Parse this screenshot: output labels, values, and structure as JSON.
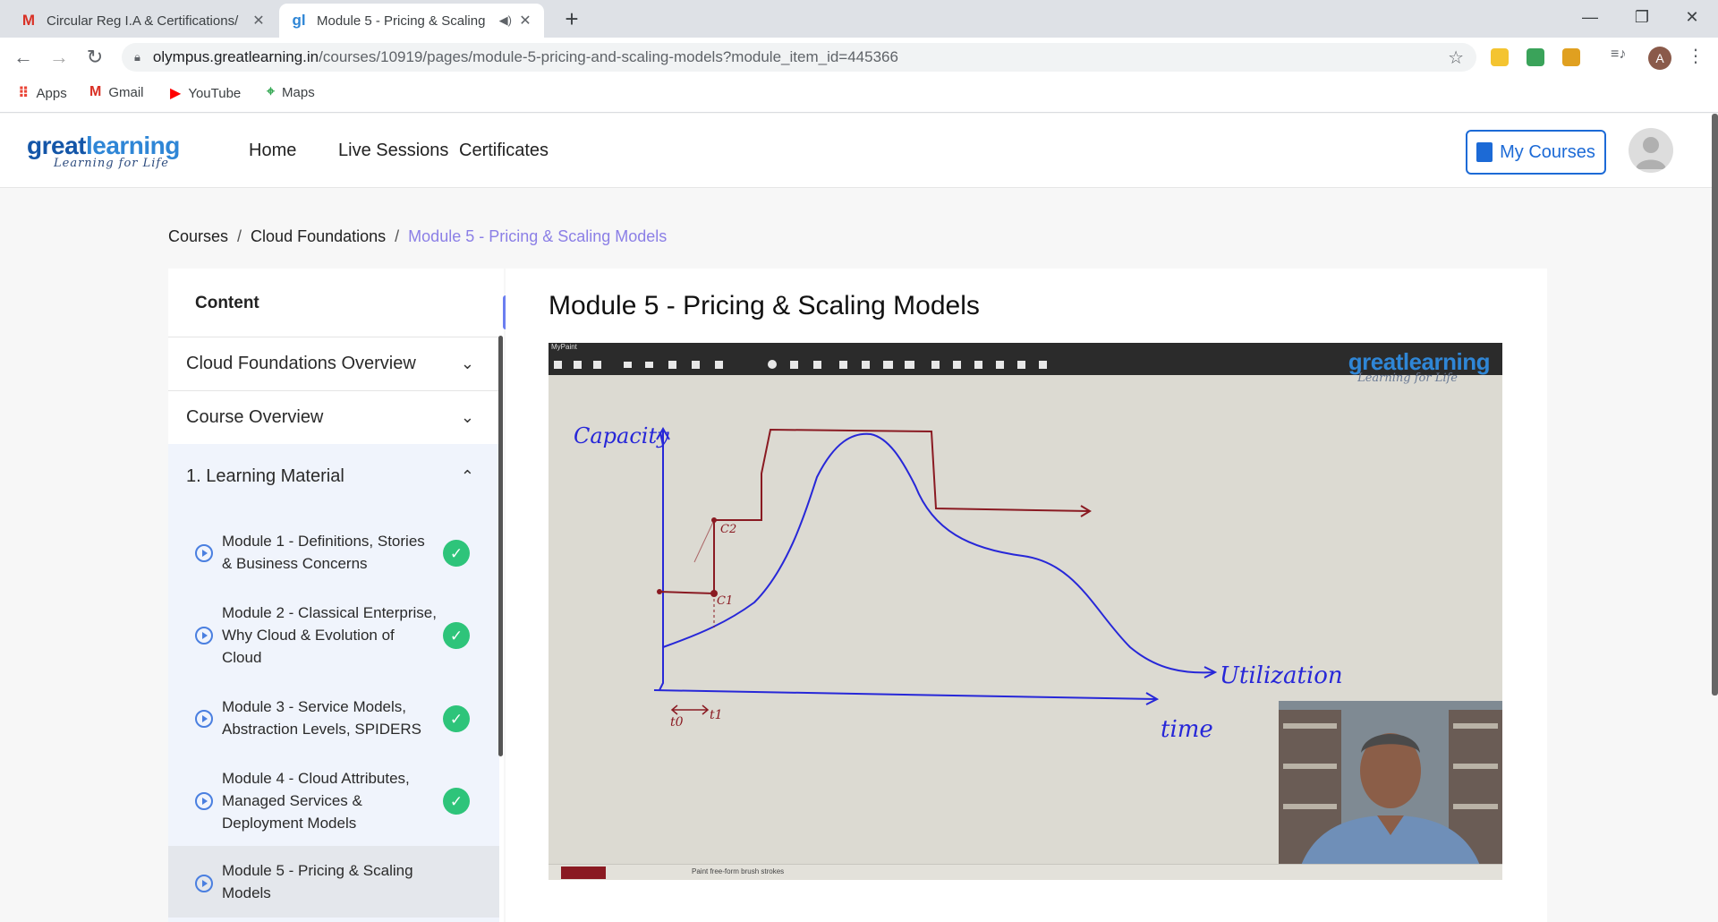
{
  "browser": {
    "tabs": [
      {
        "title": "Circular Reg I.A & Certifications/",
        "active": false
      },
      {
        "title": "Module 5 - Pricing & Scaling",
        "active": true
      }
    ],
    "url_host": "olympus.greatlearning.in",
    "url_path": "/courses/10919/pages/module-5-pricing-and-scaling-models?module_item_id=445366",
    "profile_initial": "A",
    "bookmarks": [
      "Apps",
      "Gmail",
      "YouTube",
      "Maps"
    ]
  },
  "site": {
    "logo_brand_a": "great",
    "logo_brand_b": "learning",
    "logo_tagline": "Learning for Life",
    "nav": [
      "Home",
      "Live Sessions",
      "Certificates"
    ],
    "my_courses": "My Courses"
  },
  "breadcrumb": {
    "items": [
      "Courses",
      "Cloud Foundations",
      "Module 5 - Pricing & Scaling Models"
    ],
    "separator": "/"
  },
  "sidebar": {
    "heading": "Content",
    "sections": [
      {
        "label": "Cloud Foundations Overview",
        "expanded": false
      },
      {
        "label": "Course Overview",
        "expanded": false
      },
      {
        "label": "1. Learning Material",
        "expanded": true
      }
    ],
    "items": [
      {
        "label": "Module 1 - Definitions, Stories & Business Concerns",
        "completed": true
      },
      {
        "label": "Module 2 - Classical Enterprise, Why Cloud & Evolution of Cloud",
        "completed": true
      },
      {
        "label": "Module 3 - Service Models, Abstraction Levels, SPIDERS",
        "completed": true
      },
      {
        "label": "Module 4 - Cloud Attributes, Managed Services & Deployment Models",
        "completed": true
      },
      {
        "label": "Module 5 - Pricing & Scaling Models",
        "completed": false,
        "current": true
      }
    ]
  },
  "main": {
    "title": "Module 5 - Pricing & Scaling Models",
    "video": {
      "app_title": "MyPaint",
      "watermark": "greatlearning",
      "watermark_tagline": "Learning for Life",
      "status_text": "Paint free-form brush strokes",
      "brush_color": "#8a1a22",
      "whiteboard": {
        "capacity_label": "Capacity",
        "utilization_label": "Utilization",
        "time_label": "time",
        "c1": "C1",
        "c2": "C2",
        "t0": "t0",
        "t1": "t1"
      }
    }
  },
  "colors": {
    "accent": "#1c6ad6",
    "breadcrumb_current": "#8b7fe6",
    "check": "#2ec47a",
    "collapse_btn": "#6b7ef0",
    "ink_blue": "#2727d8",
    "ink_red": "#8a1a22"
  }
}
